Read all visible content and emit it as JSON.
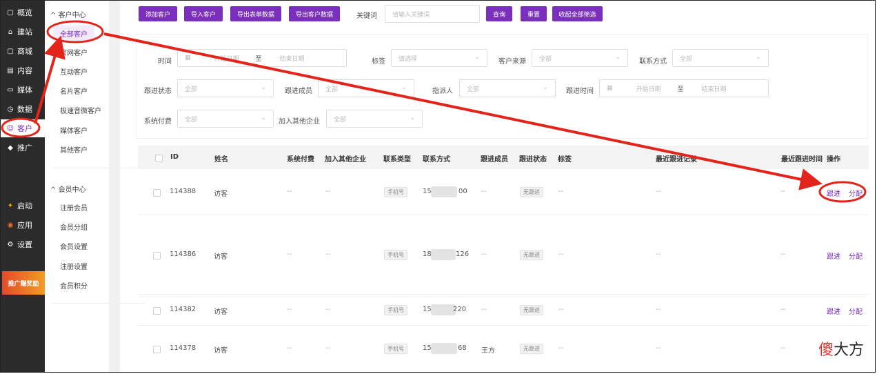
{
  "nav": {
    "items": [
      {
        "icon": "storefront-icon",
        "glyph": "▢",
        "label": "概览"
      },
      {
        "icon": "home-icon",
        "glyph": "⌂",
        "label": "建站"
      },
      {
        "icon": "shop-icon",
        "glyph": "▢",
        "label": "商城"
      },
      {
        "icon": "document-icon",
        "glyph": "▤",
        "label": "内容"
      },
      {
        "icon": "media-icon",
        "glyph": "▭",
        "label": "媒体"
      },
      {
        "icon": "clock-icon",
        "glyph": "◷",
        "label": "数据"
      },
      {
        "icon": "user-icon",
        "glyph": "☺",
        "label": "客户"
      },
      {
        "icon": "tag-icon",
        "glyph": "◆",
        "label": "推广"
      },
      {
        "icon": "launch-icon",
        "glyph": "✦",
        "label": "启动"
      },
      {
        "icon": "apps-icon",
        "glyph": "◉",
        "label": "应用"
      },
      {
        "icon": "settings-icon",
        "glyph": "⚙",
        "label": "设置"
      }
    ],
    "promo": "推广赚奖励"
  },
  "submenu": {
    "group1_title": "客户中心",
    "group1_items": [
      "全部客户",
      "官网客户",
      "互动客户",
      "名片客户",
      "极速音微客户",
      "媒体客户",
      "其他客户"
    ],
    "group2_title": "会员中心",
    "group2_items": [
      "注册会员",
      "会员分组",
      "会员设置",
      "注册设置",
      "会员积分"
    ]
  },
  "toolbar": {
    "add": "添加客户",
    "import": "导入客户",
    "export_form": "导出表单数据",
    "export_customer": "导出客户数据",
    "keyword_label": "关键词",
    "keyword_placeholder": "请输入关键词",
    "search": "查询",
    "reset": "重置",
    "collapse": "收起全部筛选"
  },
  "filters": {
    "time_label": "时间",
    "start_date": "开始日期",
    "to": "至",
    "end_date": "结束日期",
    "tag_label": "标签",
    "tag_placeholder": "请选择",
    "source_label": "客户来源",
    "source_value": "全部",
    "contact_label": "联系方式",
    "contact_value": "全部",
    "follow_status_label": "跟进状态",
    "follow_status_value": "全部",
    "follow_member_label": "跟进成员",
    "follow_member_value": "全部",
    "assignee_label": "指派人",
    "assignee_value": "全部",
    "follow_time_label": "跟进时间",
    "follow_start": "开始日期",
    "follow_to": "至",
    "follow_end": "结束日期",
    "paid_label": "系统付费",
    "paid_value": "全部",
    "other_ent_label": "加入其他企业",
    "other_ent_value": "全部"
  },
  "table": {
    "headers": [
      "ID",
      "姓名",
      "系统付费",
      "加入其他企业",
      "联系类型",
      "联系方式",
      "跟进成员",
      "跟进状态",
      "标签",
      "最近跟进记录",
      "最近跟进时间",
      "操作"
    ],
    "rows": [
      {
        "id": "114388",
        "name": "访客",
        "paid": "--",
        "other": "--",
        "type": "手机号",
        "phone_a": "15",
        "phone_b": "00",
        "member": "--",
        "status": "无跟进",
        "tag": "--",
        "record": "--",
        "time": "--",
        "follow": "跟进",
        "assign": "分配"
      },
      {
        "id": "114386",
        "name": "访客",
        "paid": "--",
        "other": "--",
        "type": "手机号",
        "phone_a": "18",
        "phone_b": "126",
        "member": "--",
        "status": "无跟进",
        "tag": "--",
        "record": "--",
        "time": "--",
        "follow": "跟进",
        "assign": "分配"
      },
      {
        "id": "114382",
        "name": "访客",
        "paid": "--",
        "other": "--",
        "type": "手机号",
        "phone_a": "15",
        "phone_b": "220",
        "member": "--",
        "status": "无跟进",
        "tag": "--",
        "record": "--",
        "time": "--",
        "follow": "跟进",
        "assign": "分配"
      },
      {
        "id": "114378",
        "name": "访客",
        "paid": "--",
        "other": "--",
        "type": "手机号",
        "phone_a": "15",
        "phone_b": "68",
        "member": "王方",
        "status": "无跟进",
        "tag": "--",
        "record": "--",
        "time": "--",
        "follow": "",
        "assign": ""
      }
    ]
  },
  "watermark": {
    "part1": "傻",
    "part2": "大方"
  },
  "colors": {
    "accent": "#7b2fbe",
    "highlight": "#e3241b",
    "nav_bg": "#2b2b2b"
  }
}
